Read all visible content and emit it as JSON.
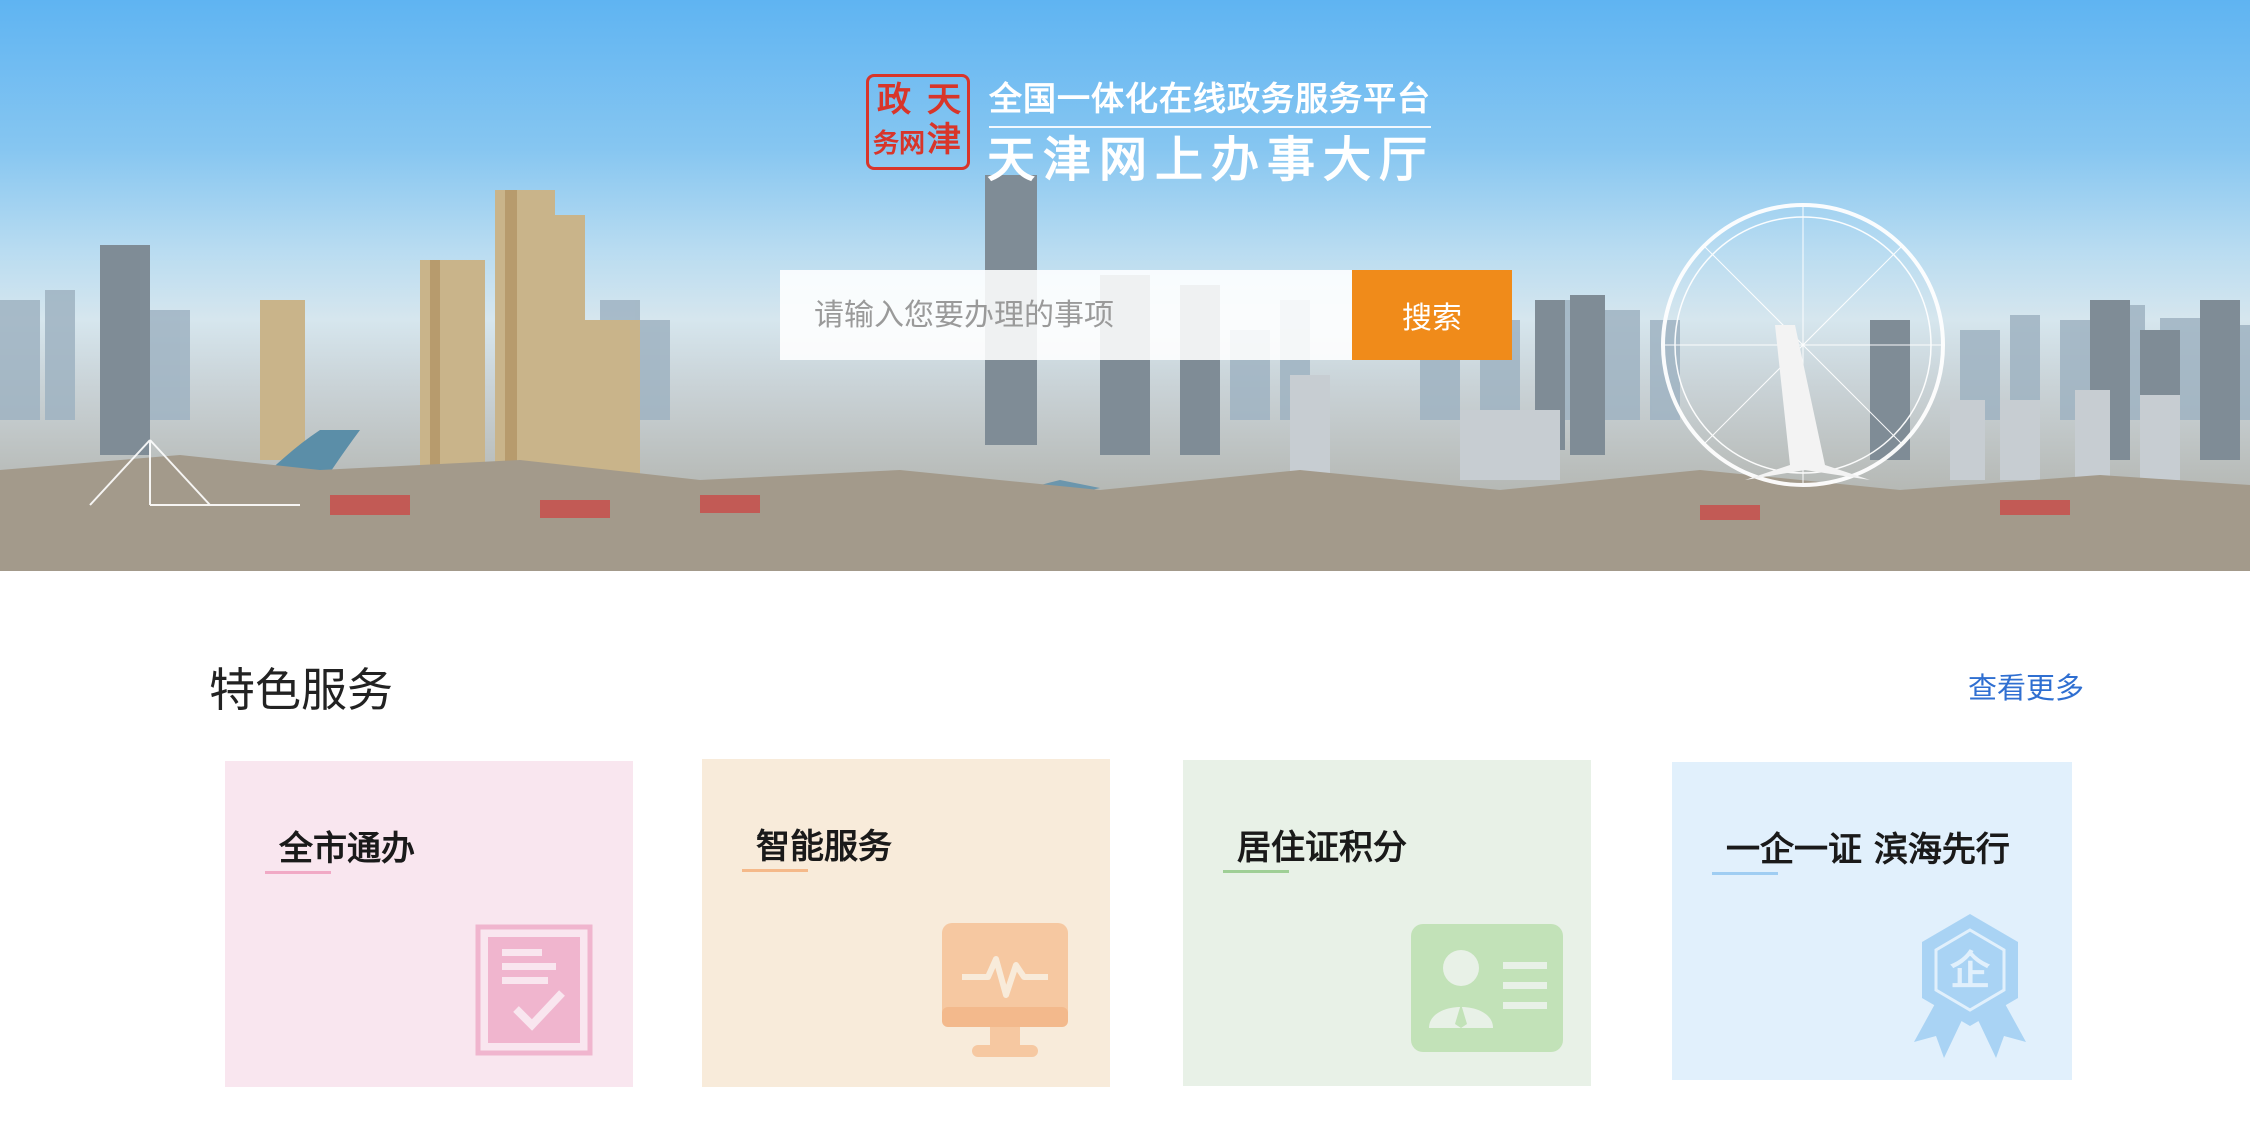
{
  "header": {
    "seal_chars": [
      "天",
      "津",
      "政",
      "务网"
    ],
    "platform_subtitle": "全国一体化在线政务服务平台",
    "platform_title": "天津网上办事大厅"
  },
  "search": {
    "placeholder": "请输入您要办理的事项",
    "button_label": "搜索"
  },
  "section": {
    "title": "特色服务",
    "more_label": "查看更多"
  },
  "cards": [
    {
      "title": "全市通办",
      "accent": "#f1a9c5",
      "icon": "document-check-icon"
    },
    {
      "title": "智能服务",
      "accent": "#f5b98a",
      "icon": "monitor-pulse-icon"
    },
    {
      "title": "居住证积分",
      "accent": "#9fcf96",
      "icon": "id-card-icon"
    },
    {
      "title": "一企一证 滨海先行",
      "accent": "#9fcdf2",
      "icon": "enterprise-badge-icon"
    }
  ],
  "colors": {
    "search_button": "#f08b1a",
    "link": "#2f6fd1",
    "seal": "#d8352a"
  }
}
